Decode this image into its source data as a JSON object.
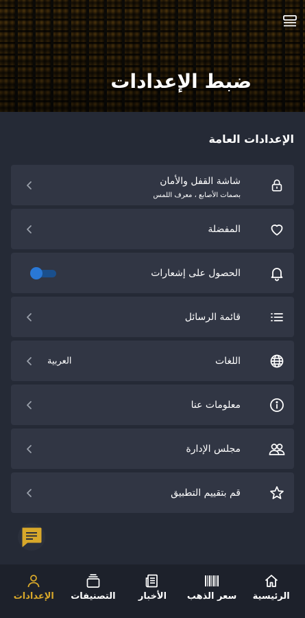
{
  "header": {
    "title": "ضبط الإعدادات",
    "menu_icon": "menu-icon"
  },
  "section": {
    "title": "الإعدادات العامة"
  },
  "settings": [
    {
      "id": "lock",
      "label": "شاشة القفل والأمان",
      "sublabel": "بصمات الأصابع ، معرف اللمس",
      "icon": "lock-icon",
      "control": "chevron"
    },
    {
      "id": "favorites",
      "label": "المفضلة",
      "icon": "heart-icon",
      "control": "chevron"
    },
    {
      "id": "notifications",
      "label": "الحصول على إشعارات",
      "icon": "bell-icon",
      "control": "toggle",
      "toggle_on": false
    },
    {
      "id": "messages",
      "label": "قائمة الرسائل",
      "icon": "list-icon",
      "control": "chevron"
    },
    {
      "id": "languages",
      "label": "اللغات",
      "value": "العربية",
      "icon": "globe-icon",
      "control": "chevron"
    },
    {
      "id": "about",
      "label": "معلومات عنا",
      "icon": "info-icon",
      "control": "chevron"
    },
    {
      "id": "board",
      "label": "مجلس الإدارة",
      "icon": "users-icon",
      "control": "chevron"
    },
    {
      "id": "rate",
      "label": "قم بتقييم التطبيق",
      "icon": "star-icon",
      "control": "chevron"
    }
  ],
  "bottom_nav": [
    {
      "id": "home",
      "label": "الرئيسية",
      "icon": "home-icon",
      "active": false
    },
    {
      "id": "gold",
      "label": "سعر الذهب",
      "icon": "barcode-icon",
      "active": false
    },
    {
      "id": "news",
      "label": "الأخبار",
      "icon": "newspaper-icon",
      "active": false
    },
    {
      "id": "categories",
      "label": "التصنيفات",
      "icon": "layers-icon",
      "active": false
    },
    {
      "id": "settings",
      "label": "الإعدادات",
      "icon": "user-icon",
      "active": true
    }
  ],
  "colors": {
    "background": "#252a36",
    "card": "#313644",
    "accent_gold": "#d8a82a",
    "toggle_blue": "#2978d6",
    "nav_background": "#1d212b"
  }
}
